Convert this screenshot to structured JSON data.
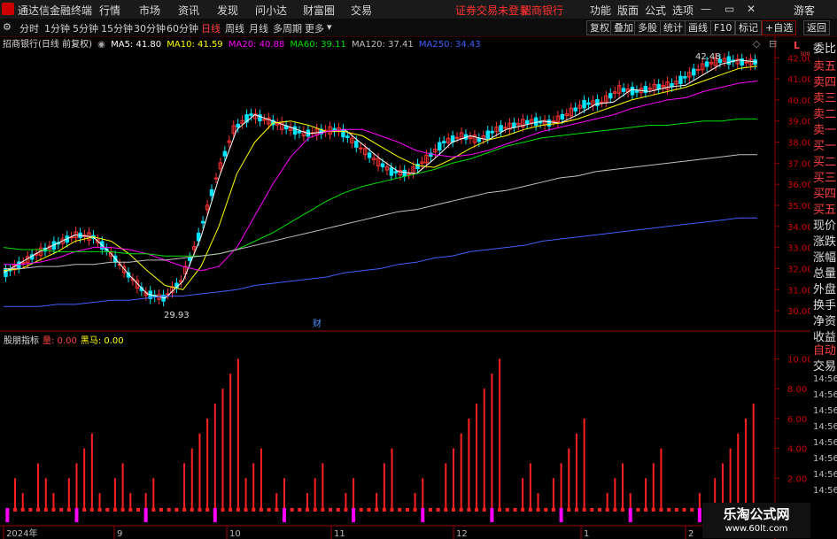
{
  "menu": {
    "app_name": "通达信金融终端",
    "items": [
      "行情",
      "市场",
      "资讯",
      "发现",
      "问小达",
      "财富圈",
      "交易"
    ],
    "warning": "证券交易未登录",
    "stock_link": "招商银行",
    "right_items": [
      "功能",
      "版面",
      "公式",
      "选项"
    ],
    "user": "游客"
  },
  "toolbar": {
    "timeframes": [
      "分时",
      "1分钟",
      "5分钟",
      "15分钟",
      "30分钟",
      "60分钟",
      "日线",
      "周线",
      "月线",
      "多周期",
      "更多"
    ],
    "active_timeframe": "日线",
    "buttons": [
      "复权",
      "叠加",
      "多股",
      "统计",
      "画线",
      "F10",
      "标记",
      "+自选",
      "返回"
    ]
  },
  "chart_header": {
    "title": "招商银行(日线 前复权)",
    "ma": [
      {
        "label": "MA5: 41.80",
        "color": "#ffffff"
      },
      {
        "label": "MA10: 41.59",
        "color": "#ffff00"
      },
      {
        "label": "MA20: 40.88",
        "color": "#ff00ff"
      },
      {
        "label": "MA60: 39.11",
        "color": "#00e000"
      },
      {
        "label": "MA120: 37.41",
        "color": "#c0c0c0"
      },
      {
        "label": "MA250: 34.43",
        "color": "#4060ff"
      }
    ],
    "corner": "L",
    "corner_sub": "300"
  },
  "side_panel": {
    "labels": [
      "委比",
      "卖五",
      "卖四",
      "卖三",
      "卖二",
      "卖一",
      "买一",
      "买二",
      "买三",
      "买四",
      "买五",
      "现价",
      "涨跌",
      "涨幅",
      "总量",
      "外盘",
      "换手",
      "净资",
      "收益"
    ],
    "bottom_labels": [
      "自动",
      "交易"
    ],
    "times": [
      "14:56",
      "14:56",
      "14:56",
      "14:56",
      "14:56",
      "14:56",
      "14:56",
      "14:56"
    ]
  },
  "indicator": {
    "name": "股朋指标",
    "v1": "量: 0.00",
    "v2": "黑马: 0.00"
  },
  "annotations": {
    "high": "42.48",
    "low": "29.93",
    "fin_marker": "财"
  },
  "watermark": {
    "line1": "乐淘公式网",
    "line2": "www.60lt.com"
  },
  "colors": {
    "up": "#ff3232",
    "down": "#00e5ff",
    "bar": "#ff2020",
    "pink": "#ff00ff"
  },
  "chart_data": [
    {
      "type": "candlestick",
      "title": "招商银行(日线 前复权)",
      "ylim": [
        29.5,
        42.6
      ],
      "y_ticks": [
        30.0,
        31.0,
        32.0,
        33.0,
        34.0,
        35.0,
        36.0,
        37.0,
        38.0,
        39.0,
        40.0,
        41.0,
        42.0
      ],
      "x_ticks": [
        "2024年",
        "9",
        "10",
        "11",
        "12",
        "1",
        "2"
      ],
      "series": [
        {
          "name": "MA5",
          "values": [
            31.8,
            32.3,
            32.8,
            33.2,
            33.6,
            33.5,
            32.7,
            31.7,
            30.8,
            30.6,
            31.4,
            33.5,
            36.3,
            38.6,
            39.3,
            39.0,
            38.7,
            38.4,
            38.5,
            38.6,
            37.9,
            37.2,
            36.6,
            36.5,
            37.2,
            38.0,
            38.3,
            38.1,
            38.6,
            38.8,
            39.0,
            38.9,
            39.3,
            39.8,
            39.9,
            40.5,
            40.4,
            40.6,
            40.7,
            41.2,
            41.7,
            41.9,
            41.8
          ]
        },
        {
          "name": "MA10",
          "values": [
            31.9,
            32.0,
            32.4,
            32.8,
            33.3,
            33.5,
            33.3,
            32.7,
            31.9,
            31.2,
            31.0,
            32.1,
            34.0,
            36.5,
            38.0,
            38.9,
            39.0,
            38.8,
            38.5,
            38.5,
            38.3,
            37.8,
            37.3,
            36.9,
            36.8,
            37.2,
            37.7,
            38.1,
            38.3,
            38.6,
            38.8,
            38.9,
            39.1,
            39.4,
            39.7,
            40.0,
            40.2,
            40.4,
            40.6,
            40.9,
            41.2,
            41.5,
            41.6
          ]
        },
        {
          "name": "MA20",
          "values": [
            32.2,
            32.2,
            32.3,
            32.5,
            32.8,
            33.0,
            33.0,
            32.9,
            32.7,
            32.4,
            32.1,
            31.9,
            32.1,
            33.0,
            34.5,
            36.0,
            37.3,
            38.2,
            38.5,
            38.6,
            38.6,
            38.3,
            38.0,
            37.6,
            37.4,
            37.3,
            37.4,
            37.6,
            37.9,
            38.2,
            38.5,
            38.7,
            38.9,
            39.1,
            39.3,
            39.6,
            39.8,
            40.0,
            40.1,
            40.4,
            40.6,
            40.8,
            40.9
          ]
        },
        {
          "name": "MA60",
          "values": [
            33.0,
            32.9,
            32.9,
            32.8,
            32.8,
            32.8,
            32.8,
            32.7,
            32.7,
            32.6,
            32.6,
            32.6,
            32.7,
            32.9,
            33.3,
            33.7,
            34.2,
            34.7,
            35.2,
            35.6,
            35.9,
            36.1,
            36.3,
            36.5,
            36.7,
            37.0,
            37.2,
            37.5,
            37.8,
            38.0,
            38.2,
            38.3,
            38.4,
            38.5,
            38.6,
            38.7,
            38.8,
            38.8,
            38.9,
            39.0,
            39.0,
            39.1,
            39.1
          ]
        },
        {
          "name": "MA120",
          "values": [
            32.0,
            32.0,
            32.1,
            32.1,
            32.2,
            32.2,
            32.3,
            32.3,
            32.4,
            32.4,
            32.5,
            32.6,
            32.7,
            32.9,
            33.1,
            33.3,
            33.5,
            33.7,
            33.9,
            34.1,
            34.3,
            34.5,
            34.7,
            34.8,
            35.0,
            35.2,
            35.4,
            35.6,
            35.7,
            35.9,
            36.1,
            36.3,
            36.4,
            36.6,
            36.7,
            36.8,
            36.9,
            37.0,
            37.1,
            37.2,
            37.3,
            37.4,
            37.4
          ]
        },
        {
          "name": "MA250",
          "values": [
            30.2,
            30.2,
            30.2,
            30.3,
            30.3,
            30.4,
            30.5,
            30.5,
            30.6,
            30.7,
            30.7,
            30.8,
            30.9,
            31.0,
            31.2,
            31.3,
            31.4,
            31.5,
            31.6,
            31.8,
            31.9,
            32.0,
            32.2,
            32.3,
            32.5,
            32.6,
            32.8,
            32.9,
            33.0,
            33.1,
            33.3,
            33.4,
            33.5,
            33.6,
            33.7,
            33.8,
            33.9,
            34.0,
            34.1,
            34.2,
            34.3,
            34.4,
            34.4
          ]
        }
      ]
    },
    {
      "type": "bar",
      "title": "股朋指标",
      "ylim": [
        0,
        10.5
      ],
      "y_ticks": [
        2.0,
        4.0,
        6.0,
        8.0,
        10.0
      ],
      "series": [
        {
          "name": "量",
          "values": [
            0,
            2,
            1,
            0,
            3,
            2,
            1,
            0,
            2,
            3,
            4,
            5,
            1,
            0,
            2,
            3,
            1,
            0,
            1,
            2,
            0,
            0,
            0,
            3,
            4,
            5,
            6,
            7,
            8,
            9,
            10,
            2,
            3,
            4,
            0,
            1,
            2,
            0,
            0,
            1,
            2,
            3,
            0,
            0,
            1,
            2,
            0,
            0,
            1,
            3,
            4,
            0,
            0,
            1,
            2,
            0,
            0,
            3,
            4,
            5,
            6,
            7,
            8,
            9,
            10,
            0,
            0,
            2,
            3,
            1,
            0,
            2,
            3,
            4,
            5,
            6,
            0,
            0,
            1,
            2,
            3,
            1,
            0,
            2,
            3,
            4,
            0,
            0,
            0,
            0,
            1,
            0,
            2,
            3,
            4,
            5,
            6,
            7
          ]
        }
      ]
    }
  ]
}
